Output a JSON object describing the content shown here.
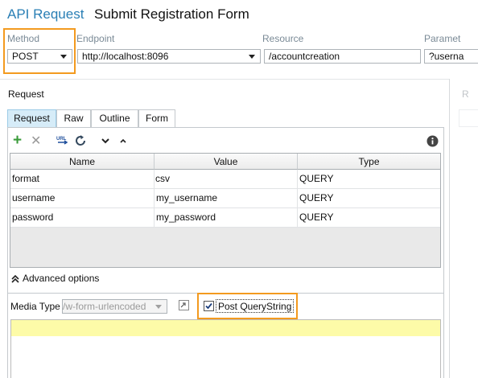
{
  "header": {
    "api_label": "API Request",
    "title": "Submit Registration Form"
  },
  "request_line": {
    "method_label": "Method",
    "method_value": "POST",
    "endpoint_label": "Endpoint",
    "endpoint_value": "http://localhost:8096",
    "resource_label": "Resource",
    "resource_value": "/accountcreation",
    "params_label": "Paramet",
    "params_value": "?userna"
  },
  "request_panel": {
    "title": "Request",
    "right_panel_initial": "R",
    "tabs": [
      {
        "label": "Request",
        "active": true
      },
      {
        "label": "Raw",
        "active": false
      },
      {
        "label": "Outline",
        "active": false
      },
      {
        "label": "Form",
        "active": false
      }
    ],
    "toolbar": {
      "add_icon": "plus-icon",
      "remove_icon": "x-icon",
      "url_icon": "url-icon",
      "refresh_icon": "refresh-icon",
      "move_down_icon": "chevron-down-icon",
      "move_up_icon": "chevron-up-icon",
      "info_icon": "info-icon"
    },
    "table": {
      "columns": [
        "Name",
        "Value",
        "Type"
      ],
      "rows": [
        {
          "name": "format",
          "value": "csv",
          "type": "QUERY"
        },
        {
          "name": "username",
          "value": "my_username",
          "type": "QUERY"
        },
        {
          "name": "password",
          "value": "my_password",
          "type": "QUERY"
        }
      ]
    },
    "advanced_options_label": "Advanced options",
    "media_type_label": "Media Type",
    "media_type_value": "/w-form-urlencoded",
    "post_querystring_label": "Post QueryString",
    "post_querystring_checked": true
  },
  "colors": {
    "accent_blue": "#2a7fb5",
    "highlight_orange": "#f39a1f",
    "body_yellow": "#fdfba8",
    "active_tab": "#d6ecf8"
  }
}
